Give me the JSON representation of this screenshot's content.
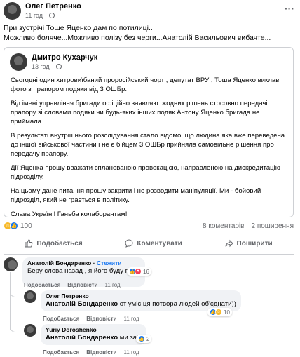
{
  "post": {
    "author": "Олег Петренко",
    "time": "11 год",
    "menu_icon": "more-dots-icon",
    "text_line1": "При зустрічі Тоше Яценко дам по потилиці..",
    "text_line2": "Можливо боляче...Можливо полізу без черги...Анатолій Васильович вибачте..."
  },
  "shared": {
    "author": "Дмитро Кухарчук",
    "time": "13 год",
    "paragraphs": [
      "Сьогодні один хитровиїбаний проросійський чорт , депутат ВРУ , Тоша Яценко виклав фото з прапором подяки від 3 ОШБр.",
      "Від імені управління бригади офіційно заявляю: жодних рішень стосовно передачі прапору зі словами подяки чи будь-яких інших подяк Антону Яценко бригада не приймала.",
      "В результаті внутрішнього розслідування стало відомо, що людина яка вже переведена до іншої військової частини і не є бійцем 3 ОШБр прийняла самовільне рішення про передачу прапору.",
      "Дії Яценка прошу вважати спланованою провокацією, направленою на дискредитацію підрозділу.",
      "На цьому дане питання прошу закрити і не розводити маніпуляції. Ми - бойовий підрозділ, який не грається в політику.",
      "Слава Україні! Ганьба колаборантам!"
    ]
  },
  "stats": {
    "reaction_count": "100",
    "comments": "8 коментарів",
    "shares": "2 поширення"
  },
  "actions": {
    "like": "Подобається",
    "comment": "Коментувати",
    "share": "Поширити"
  },
  "comments": [
    {
      "author": "Анатолій Бондаренко",
      "follow": "Стежити",
      "text": "Беру слова назад , я його буду п....и .",
      "like": "Подобається",
      "reply": "Відповісти",
      "time": "11 год",
      "reactions": "16"
    },
    {
      "author": "Олег Петренко",
      "mention": "Анатолій Бондаренко",
      "text": " от уміє ця потвора людей об'єднати))",
      "like": "Подобається",
      "reply": "Відповісти",
      "time": "11 год",
      "reactions": "10"
    },
    {
      "author": "Yuriy Doroshenko",
      "mention": "Анатолій Бондаренко",
      "text": " ми за))",
      "like": "Подобається",
      "reply": "Відповісти",
      "time": "11 год",
      "reactions": "2"
    }
  ],
  "colors": {
    "accent": "#1877f2",
    "secondary_text": "#65676b",
    "bubble": "#f0f2f5"
  }
}
